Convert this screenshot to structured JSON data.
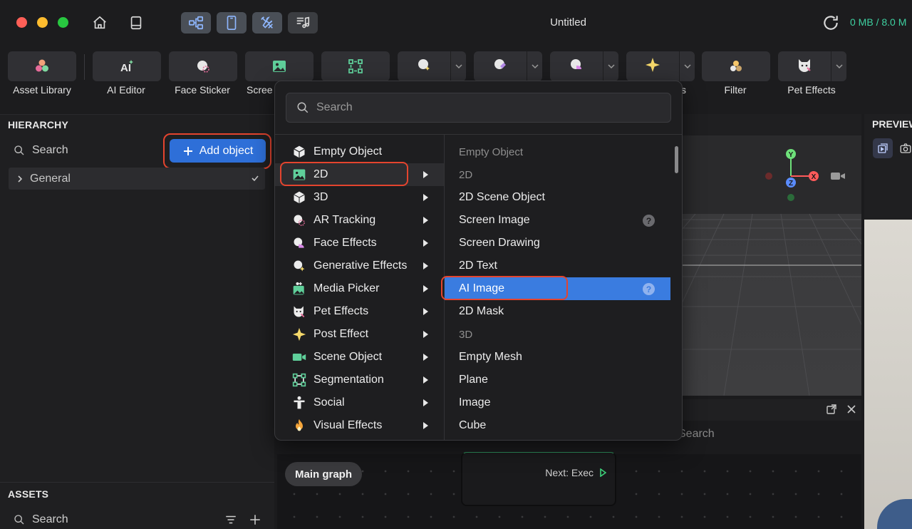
{
  "window": {
    "title": "Untitled",
    "memory": "0 MB / 8.0 M"
  },
  "toolbar": {
    "items": [
      {
        "label": "Asset Library"
      },
      {
        "label": "AI Editor"
      },
      {
        "label": "Face Sticker"
      },
      {
        "label": "Scree"
      },
      {
        "label": ""
      },
      {
        "label": ""
      },
      {
        "label": ""
      },
      {
        "label": ""
      },
      {
        "label": "s"
      },
      {
        "label": "Filter"
      },
      {
        "label": "Pet Effects"
      }
    ]
  },
  "hierarchy": {
    "title": "HIERARCHY",
    "search_placeholder": "Search",
    "add_object_label": "Add object",
    "group_label": "General"
  },
  "assets": {
    "title": "ASSETS",
    "search_placeholder": "Search"
  },
  "preview": {
    "title": "PREVIEW"
  },
  "graph": {
    "search_placeholder": "Search",
    "main_graph_label": "Main graph",
    "node_label": "Next: Exec"
  },
  "menu": {
    "search_placeholder": "Search",
    "categories": [
      {
        "label": "Empty Object",
        "icon": "cube-outline-icon",
        "has_submenu": false
      },
      {
        "label": "2D",
        "icon": "image-icon",
        "has_submenu": true
      },
      {
        "label": "3D",
        "icon": "cube-icon",
        "has_submenu": true
      },
      {
        "label": "AR Tracking",
        "icon": "ar-tracking-icon",
        "has_submenu": true
      },
      {
        "label": "Face Effects",
        "icon": "face-effects-icon",
        "has_submenu": true
      },
      {
        "label": "Generative Effects",
        "icon": "generative-effects-icon",
        "has_submenu": true
      },
      {
        "label": "Media Picker",
        "icon": "media-picker-icon",
        "has_submenu": true
      },
      {
        "label": "Pet Effects",
        "icon": "pet-effects-icon",
        "has_submenu": true
      },
      {
        "label": "Post Effect",
        "icon": "sparkle-icon",
        "has_submenu": true
      },
      {
        "label": "Scene Object",
        "icon": "camera-icon",
        "has_submenu": true
      },
      {
        "label": "Segmentation",
        "icon": "segmentation-icon",
        "has_submenu": true
      },
      {
        "label": "Social",
        "icon": "person-icon",
        "has_submenu": true
      },
      {
        "label": "Visual Effects",
        "icon": "fire-icon",
        "has_submenu": true
      }
    ],
    "active_category": "2D",
    "submenu": [
      {
        "label": "Empty Object",
        "type": "header"
      },
      {
        "label": "2D",
        "type": "header"
      },
      {
        "label": "2D Scene Object",
        "type": "item"
      },
      {
        "label": "Screen Image",
        "type": "item",
        "help": "?"
      },
      {
        "label": "Screen Drawing",
        "type": "item"
      },
      {
        "label": "2D Text",
        "type": "item"
      },
      {
        "label": "AI Image",
        "type": "item",
        "help": "?",
        "selected": true
      },
      {
        "label": "2D Mask",
        "type": "item"
      },
      {
        "label": "3D",
        "type": "header"
      },
      {
        "label": "Empty Mesh",
        "type": "item"
      },
      {
        "label": "Plane",
        "type": "item"
      },
      {
        "label": "Image",
        "type": "item"
      },
      {
        "label": "Cube",
        "type": "item"
      }
    ]
  },
  "gizmo": {
    "y_label": "Y",
    "x_label": "X",
    "z_label": "Z"
  },
  "colors": {
    "accent_blue": "#2e6fd8",
    "selection_blue": "#3a7ce0",
    "highlight_red": "#e4442e",
    "memory_green": "#3ed1a1"
  }
}
